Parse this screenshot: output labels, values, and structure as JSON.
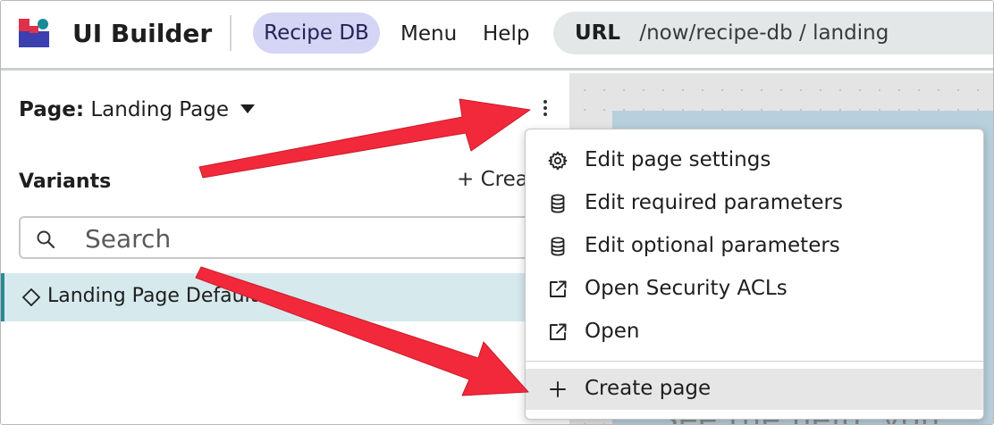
{
  "header": {
    "app_title": "UI Builder",
    "app_pill": "Recipe DB",
    "menu": "Menu",
    "help": "Help",
    "url_label": "URL",
    "url_path": "/now/recipe-db / landing"
  },
  "panel": {
    "page_label": "Page:",
    "page_value": "Landing Page",
    "variants_title": "Variants",
    "create_variant": "+ Crea",
    "search": {
      "placeholder": "Search"
    },
    "variant_row": "Landing Page Default"
  },
  "canvas": {
    "text": "See the help, you"
  },
  "dropdown": {
    "items": [
      {
        "label": "Edit page settings",
        "icon": "gear-icon"
      },
      {
        "label": "Edit required parameters",
        "icon": "database-icon"
      },
      {
        "label": "Edit optional parameters",
        "icon": "database-icon"
      },
      {
        "label": "Open Security ACLs",
        "icon": "external-link-icon"
      },
      {
        "label": "Open",
        "icon": "external-link-icon"
      },
      {
        "label": "Create page",
        "icon": "plus-icon"
      }
    ]
  },
  "colors": {
    "accent_pill": "#d4d4f4",
    "selected_row": "#d6e9ec",
    "selected_border": "#2b8a97",
    "annotation_arrow": "#f2293b",
    "logo_red": "#e0314a",
    "logo_blue": "#3b3fb0",
    "logo_teal": "#1a8a96"
  }
}
